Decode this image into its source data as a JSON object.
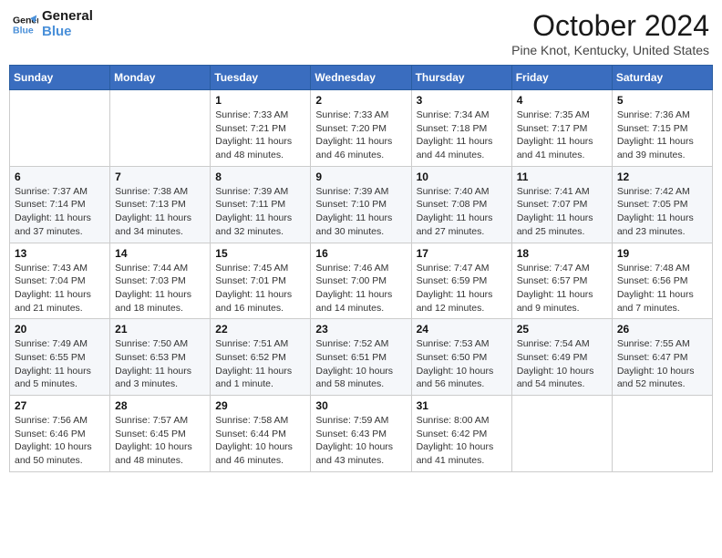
{
  "logo": {
    "line1": "General",
    "line2": "Blue"
  },
  "title": "October 2024",
  "location": "Pine Knot, Kentucky, United States",
  "days_of_week": [
    "Sunday",
    "Monday",
    "Tuesday",
    "Wednesday",
    "Thursday",
    "Friday",
    "Saturday"
  ],
  "weeks": [
    [
      {
        "day": "",
        "info": ""
      },
      {
        "day": "",
        "info": ""
      },
      {
        "day": "1",
        "info": "Sunrise: 7:33 AM\nSunset: 7:21 PM\nDaylight: 11 hours and 48 minutes."
      },
      {
        "day": "2",
        "info": "Sunrise: 7:33 AM\nSunset: 7:20 PM\nDaylight: 11 hours and 46 minutes."
      },
      {
        "day": "3",
        "info": "Sunrise: 7:34 AM\nSunset: 7:18 PM\nDaylight: 11 hours and 44 minutes."
      },
      {
        "day": "4",
        "info": "Sunrise: 7:35 AM\nSunset: 7:17 PM\nDaylight: 11 hours and 41 minutes."
      },
      {
        "day": "5",
        "info": "Sunrise: 7:36 AM\nSunset: 7:15 PM\nDaylight: 11 hours and 39 minutes."
      }
    ],
    [
      {
        "day": "6",
        "info": "Sunrise: 7:37 AM\nSunset: 7:14 PM\nDaylight: 11 hours and 37 minutes."
      },
      {
        "day": "7",
        "info": "Sunrise: 7:38 AM\nSunset: 7:13 PM\nDaylight: 11 hours and 34 minutes."
      },
      {
        "day": "8",
        "info": "Sunrise: 7:39 AM\nSunset: 7:11 PM\nDaylight: 11 hours and 32 minutes."
      },
      {
        "day": "9",
        "info": "Sunrise: 7:39 AM\nSunset: 7:10 PM\nDaylight: 11 hours and 30 minutes."
      },
      {
        "day": "10",
        "info": "Sunrise: 7:40 AM\nSunset: 7:08 PM\nDaylight: 11 hours and 27 minutes."
      },
      {
        "day": "11",
        "info": "Sunrise: 7:41 AM\nSunset: 7:07 PM\nDaylight: 11 hours and 25 minutes."
      },
      {
        "day": "12",
        "info": "Sunrise: 7:42 AM\nSunset: 7:05 PM\nDaylight: 11 hours and 23 minutes."
      }
    ],
    [
      {
        "day": "13",
        "info": "Sunrise: 7:43 AM\nSunset: 7:04 PM\nDaylight: 11 hours and 21 minutes."
      },
      {
        "day": "14",
        "info": "Sunrise: 7:44 AM\nSunset: 7:03 PM\nDaylight: 11 hours and 18 minutes."
      },
      {
        "day": "15",
        "info": "Sunrise: 7:45 AM\nSunset: 7:01 PM\nDaylight: 11 hours and 16 minutes."
      },
      {
        "day": "16",
        "info": "Sunrise: 7:46 AM\nSunset: 7:00 PM\nDaylight: 11 hours and 14 minutes."
      },
      {
        "day": "17",
        "info": "Sunrise: 7:47 AM\nSunset: 6:59 PM\nDaylight: 11 hours and 12 minutes."
      },
      {
        "day": "18",
        "info": "Sunrise: 7:47 AM\nSunset: 6:57 PM\nDaylight: 11 hours and 9 minutes."
      },
      {
        "day": "19",
        "info": "Sunrise: 7:48 AM\nSunset: 6:56 PM\nDaylight: 11 hours and 7 minutes."
      }
    ],
    [
      {
        "day": "20",
        "info": "Sunrise: 7:49 AM\nSunset: 6:55 PM\nDaylight: 11 hours and 5 minutes."
      },
      {
        "day": "21",
        "info": "Sunrise: 7:50 AM\nSunset: 6:53 PM\nDaylight: 11 hours and 3 minutes."
      },
      {
        "day": "22",
        "info": "Sunrise: 7:51 AM\nSunset: 6:52 PM\nDaylight: 11 hours and 1 minute."
      },
      {
        "day": "23",
        "info": "Sunrise: 7:52 AM\nSunset: 6:51 PM\nDaylight: 10 hours and 58 minutes."
      },
      {
        "day": "24",
        "info": "Sunrise: 7:53 AM\nSunset: 6:50 PM\nDaylight: 10 hours and 56 minutes."
      },
      {
        "day": "25",
        "info": "Sunrise: 7:54 AM\nSunset: 6:49 PM\nDaylight: 10 hours and 54 minutes."
      },
      {
        "day": "26",
        "info": "Sunrise: 7:55 AM\nSunset: 6:47 PM\nDaylight: 10 hours and 52 minutes."
      }
    ],
    [
      {
        "day": "27",
        "info": "Sunrise: 7:56 AM\nSunset: 6:46 PM\nDaylight: 10 hours and 50 minutes."
      },
      {
        "day": "28",
        "info": "Sunrise: 7:57 AM\nSunset: 6:45 PM\nDaylight: 10 hours and 48 minutes."
      },
      {
        "day": "29",
        "info": "Sunrise: 7:58 AM\nSunset: 6:44 PM\nDaylight: 10 hours and 46 minutes."
      },
      {
        "day": "30",
        "info": "Sunrise: 7:59 AM\nSunset: 6:43 PM\nDaylight: 10 hours and 43 minutes."
      },
      {
        "day": "31",
        "info": "Sunrise: 8:00 AM\nSunset: 6:42 PM\nDaylight: 10 hours and 41 minutes."
      },
      {
        "day": "",
        "info": ""
      },
      {
        "day": "",
        "info": ""
      }
    ]
  ]
}
